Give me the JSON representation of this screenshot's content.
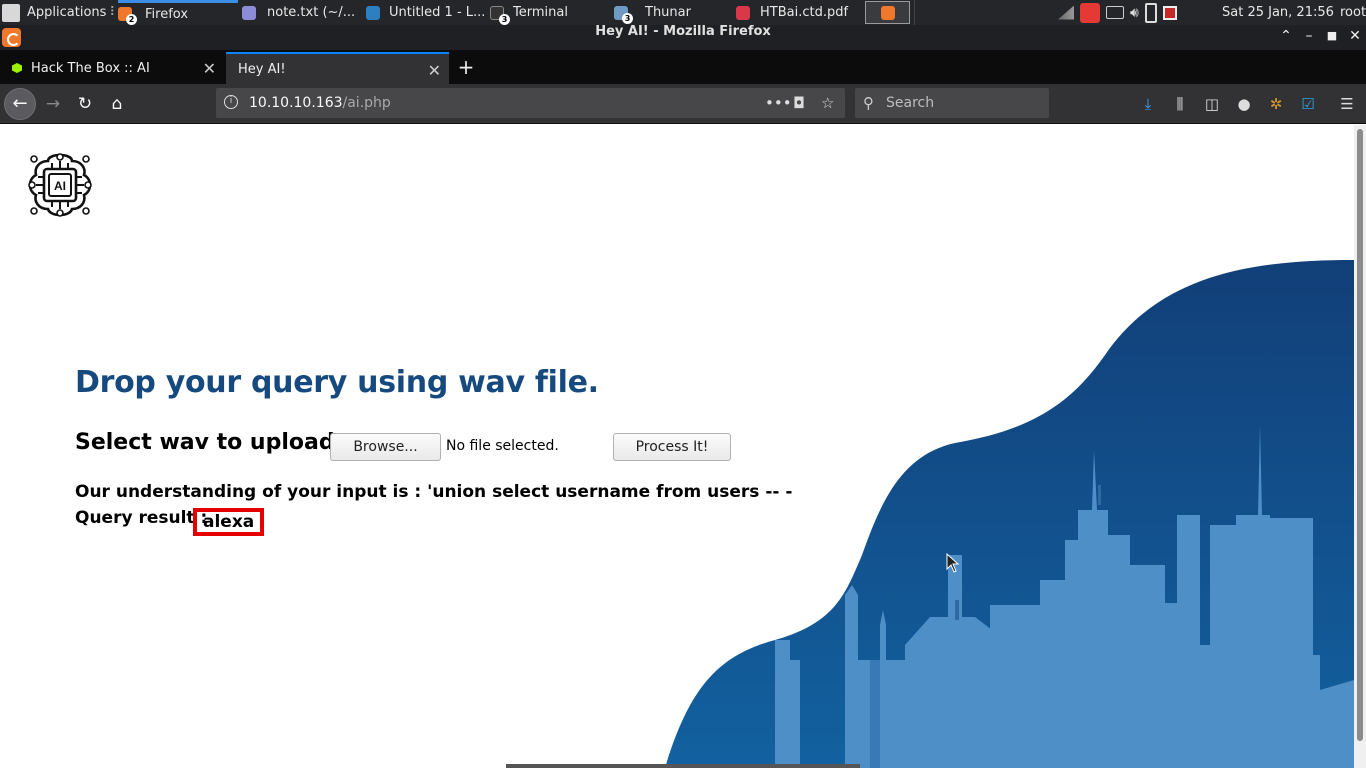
{
  "panel": {
    "applications_label": "Applications",
    "tasks": [
      {
        "label": "Firefox",
        "badge": "2"
      },
      {
        "label": "note.txt (~/..."
      },
      {
        "label": "Untitled 1 - L..."
      },
      {
        "label": "Terminal",
        "badge": "3"
      },
      {
        "label": "Thunar",
        "badge": "3"
      },
      {
        "label": "HTBai.ctd.pdf"
      }
    ],
    "clock": "Sat 25 Jan, 21:56",
    "user": "root"
  },
  "window": {
    "title": "Hey AI! - Mozilla Firefox"
  },
  "tabs": [
    {
      "label": "Hack The Box :: AI"
    },
    {
      "label": "Hey AI!"
    }
  ],
  "nav": {
    "url_host": "10.10.10.163",
    "url_path": "/ai.php",
    "search_placeholder": "Search"
  },
  "page": {
    "logo_text": "AI",
    "headline": "Drop your query using wav file.",
    "upload_label": "Select wav to upload:",
    "browse_label": "Browse...",
    "file_status": "No file selected.",
    "process_label": "Process It!",
    "understanding": "Our understanding of your input is : 'union select username from users -- -",
    "query_label": "Query result :",
    "query_result": "alexa"
  },
  "colors": {
    "headline": "#164a7e",
    "wave_dark": "#0f4c88",
    "city_light": "#4f8fc8",
    "highlight_box": "#e50000",
    "tab_accent": "#0a84ff"
  },
  "icons": {
    "download": "download-arrow-icon",
    "library": "library-icon",
    "sidebar": "sidebar-icon",
    "account": "account-icon",
    "extension_1": "cookie-icon",
    "extension_2": "checkbox-icon",
    "menu": "hamburger-menu-icon"
  }
}
